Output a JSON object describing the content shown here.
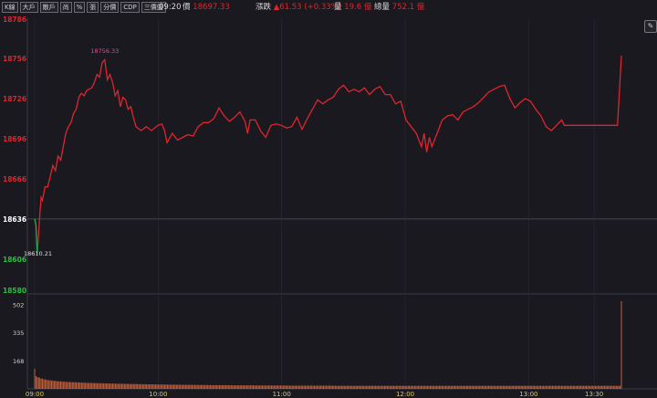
{
  "tabs": [
    "K線",
    "大戶",
    "散戶",
    "尚",
    "%",
    "張",
    "分價",
    "CDP",
    "三價盤"
  ],
  "header": {
    "time": "09:20",
    "price_label": "價",
    "price": "18697.33",
    "change_label": "漲跌",
    "change": "▲61.53 (+0.33%)",
    "volume_label": "量",
    "volume": "19.6 億",
    "total_label": "總量",
    "total": "752.1 億"
  },
  "colors": {
    "line_up": "#e0242c",
    "line_down": "#22b14c",
    "volume": "#c8603a",
    "axis_up": "#e0242c",
    "axis_down": "#22c23a",
    "ref": "#ffffff"
  },
  "chart_data": {
    "type": "line",
    "price_axis": {
      "ylim": [
        18580,
        18786
      ],
      "ticks": [
        "18786",
        "18756",
        "18726",
        "18696",
        "18666",
        "18636",
        "18606",
        "18580"
      ],
      "reference": 18636
    },
    "time_axis": {
      "ticks": [
        "09:00",
        "10:00",
        "11:00",
        "12:00",
        "13:00",
        "13:30"
      ]
    },
    "annotations": {
      "high_label": "18756.33",
      "low_label": "18610.21"
    },
    "series": [
      {
        "values": [
          [
            0,
            18636
          ],
          [
            1,
            18632
          ],
          [
            2,
            18610
          ],
          [
            3,
            18625
          ],
          [
            4,
            18640
          ],
          [
            5,
            18652
          ],
          [
            6,
            18650
          ],
          [
            8,
            18660
          ],
          [
            10,
            18660
          ],
          [
            12,
            18668
          ],
          [
            14,
            18676
          ],
          [
            16,
            18672
          ],
          [
            18,
            18683
          ],
          [
            20,
            18680
          ],
          [
            22,
            18690
          ],
          [
            24,
            18700
          ],
          [
            26,
            18705
          ],
          [
            28,
            18708
          ],
          [
            30,
            18715
          ],
          [
            32,
            18718
          ],
          [
            34,
            18727
          ],
          [
            36,
            18730
          ],
          [
            38,
            18728
          ],
          [
            40,
            18732
          ],
          [
            42,
            18733
          ],
          [
            44,
            18734
          ],
          [
            46,
            18738
          ],
          [
            48,
            18744
          ],
          [
            50,
            18742
          ],
          [
            52,
            18753
          ],
          [
            54,
            18755
          ],
          [
            56,
            18740
          ],
          [
            58,
            18744
          ],
          [
            60,
            18738
          ],
          [
            62,
            18728
          ],
          [
            64,
            18732
          ],
          [
            66,
            18720
          ],
          [
            68,
            18727
          ],
          [
            70,
            18725
          ],
          [
            72,
            18718
          ],
          [
            74,
            18720
          ],
          [
            76,
            18712
          ],
          [
            78,
            18705
          ],
          [
            82,
            18702
          ],
          [
            86,
            18705
          ],
          [
            90,
            18702
          ],
          [
            95,
            18706
          ],
          [
            98,
            18707
          ],
          [
            100,
            18702
          ],
          [
            102,
            18693
          ],
          [
            106,
            18700
          ],
          [
            110,
            18695
          ],
          [
            114,
            18697
          ],
          [
            118,
            18699
          ],
          [
            122,
            18698
          ],
          [
            126,
            18705
          ],
          [
            130,
            18708
          ],
          [
            134,
            18708
          ],
          [
            138,
            18711
          ],
          [
            142,
            18719
          ],
          [
            146,
            18713
          ],
          [
            150,
            18709
          ],
          [
            154,
            18712
          ],
          [
            158,
            18716
          ],
          [
            162,
            18709
          ],
          [
            164,
            18700
          ],
          [
            166,
            18710
          ],
          [
            170,
            18710
          ],
          [
            174,
            18702
          ],
          [
            178,
            18697
          ],
          [
            182,
            18706
          ],
          [
            186,
            18707
          ],
          [
            190,
            18706
          ],
          [
            194,
            18704
          ],
          [
            198,
            18705
          ],
          [
            202,
            18712
          ],
          [
            206,
            18703
          ],
          [
            210,
            18711
          ],
          [
            214,
            18718
          ],
          [
            218,
            18725
          ],
          [
            222,
            18722
          ],
          [
            226,
            18725
          ],
          [
            230,
            18727
          ],
          [
            234,
            18733
          ],
          [
            238,
            18736
          ],
          [
            242,
            18731
          ],
          [
            246,
            18733
          ],
          [
            250,
            18731
          ],
          [
            254,
            18734
          ],
          [
            258,
            18729
          ],
          [
            262,
            18733
          ],
          [
            266,
            18735
          ],
          [
            270,
            18729
          ],
          [
            274,
            18729
          ],
          [
            278,
            18722
          ],
          [
            282,
            18724
          ],
          [
            286,
            18710
          ],
          [
            290,
            18705
          ],
          [
            294,
            18700
          ],
          [
            298,
            18690
          ],
          [
            300,
            18700
          ],
          [
            302,
            18686
          ],
          [
            304,
            18697
          ],
          [
            306,
            18690
          ],
          [
            310,
            18700
          ],
          [
            314,
            18710
          ],
          [
            318,
            18713
          ],
          [
            322,
            18714
          ],
          [
            326,
            18710
          ],
          [
            330,
            18716
          ],
          [
            334,
            18718
          ],
          [
            338,
            18720
          ],
          [
            342,
            18723
          ],
          [
            346,
            18727
          ],
          [
            350,
            18731
          ],
          [
            354,
            18733
          ],
          [
            358,
            18735
          ],
          [
            362,
            18736
          ],
          [
            366,
            18726
          ],
          [
            370,
            18719
          ],
          [
            374,
            18723
          ],
          [
            378,
            18726
          ],
          [
            382,
            18724
          ],
          [
            386,
            18718
          ],
          [
            390,
            18713
          ],
          [
            394,
            18705
          ],
          [
            398,
            18702
          ],
          [
            402,
            18706
          ],
          [
            406,
            18710
          ],
          [
            408,
            18706
          ],
          [
            412,
            18706
          ],
          [
            416,
            18706
          ],
          [
            420,
            18706
          ],
          [
            430,
            18706
          ],
          [
            440,
            18706
          ],
          [
            449,
            18706
          ],
          [
            452,
            18758
          ]
        ]
      }
    ],
    "volume": {
      "ticks": [
        "502",
        "335",
        "168"
      ],
      "ylim": [
        0,
        520
      ],
      "values": [
        120,
        75,
        70,
        68,
        65,
        60,
        62,
        55,
        58,
        54,
        52,
        50,
        52,
        48,
        50,
        46,
        48,
        45,
        46,
        44,
        45,
        44,
        42,
        43,
        41,
        42,
        40,
        41,
        40,
        40,
        39,
        40,
        38,
        39,
        38,
        37,
        38,
        36,
        37,
        36,
        36,
        35,
        36,
        35,
        35,
        34,
        35,
        34,
        34,
        33,
        34,
        33,
        33,
        33,
        32,
        33,
        32,
        32,
        32,
        31,
        32,
        31,
        31,
        31,
        30,
        31,
        30,
        30,
        30,
        30,
        29,
        30,
        29,
        29,
        29,
        29,
        29,
        28,
        29,
        28,
        28,
        28,
        28,
        28,
        27,
        28,
        27,
        27,
        27,
        27,
        27,
        27,
        26,
        27,
        26,
        26,
        26,
        26,
        26,
        26,
        25,
        26,
        25,
        25,
        25,
        25,
        25,
        25,
        25,
        25,
        24,
        25,
        24,
        24,
        24,
        24,
        24,
        24,
        24,
        24,
        24,
        24,
        23,
        24,
        23,
        23,
        23,
        23,
        23,
        23,
        23,
        23,
        23,
        23,
        22,
        23,
        22,
        22,
        22,
        22,
        22,
        22,
        22,
        22,
        22,
        22,
        22,
        22,
        22,
        22,
        21,
        22,
        21,
        21,
        21,
        21,
        21,
        21,
        21,
        21,
        21,
        21,
        21,
        21,
        21,
        21,
        21,
        21,
        21,
        21,
        20,
        21,
        20,
        20,
        20,
        20,
        20,
        20,
        20,
        20,
        20,
        20,
        20,
        20,
        20,
        20,
        20,
        20,
        20,
        20,
        20,
        20,
        20,
        20,
        19,
        20,
        19,
        19,
        19,
        19,
        19,
        19,
        19,
        19,
        19,
        19,
        19,
        19,
        19,
        19,
        19,
        19,
        19,
        19,
        19,
        19,
        19,
        19,
        19,
        19,
        19,
        19,
        19,
        19,
        19,
        19,
        19,
        19,
        19,
        19,
        18,
        19,
        18,
        18,
        18,
        18,
        18,
        18,
        18,
        18,
        18,
        18,
        18,
        18,
        18,
        18,
        18,
        18,
        18,
        18,
        18,
        18,
        18,
        18,
        18,
        18,
        18,
        18,
        18,
        18,
        18,
        18,
        18,
        18,
        18,
        18,
        18,
        18,
        18,
        18,
        18,
        18,
        18,
        18,
        18,
        18,
        18,
        18,
        18,
        18,
        18,
        18,
        18,
        18,
        18,
        18,
        18,
        18,
        18,
        18,
        18,
        18,
        18,
        18,
        18,
        18,
        18,
        18,
        18,
        18,
        18,
        18,
        18,
        18,
        18,
        18,
        18,
        18,
        18,
        18,
        18,
        18,
        18,
        18,
        18,
        18,
        18,
        18,
        18,
        18,
        18,
        18,
        18,
        18,
        18,
        18,
        18,
        18,
        18,
        18,
        18,
        18,
        18,
        18,
        18,
        18,
        18,
        18,
        18,
        18,
        18,
        18,
        18,
        18,
        18,
        18,
        18,
        18,
        18,
        18,
        18,
        18,
        18,
        18,
        18,
        18,
        18,
        18,
        18,
        18,
        18,
        18,
        18,
        18,
        18,
        18,
        18,
        18,
        18,
        18,
        18,
        18,
        18,
        18,
        18,
        18,
        18,
        18,
        18,
        18,
        18,
        18,
        18,
        18,
        18,
        18,
        18,
        18,
        18,
        18,
        18,
        18,
        18,
        18,
        18,
        18,
        18,
        18,
        18,
        18,
        18,
        18,
        18,
        18,
        18,
        18,
        18,
        18,
        18,
        18,
        18,
        18,
        18,
        18,
        18,
        18,
        18,
        18,
        18,
        18,
        18,
        18,
        18,
        18,
        18,
        18,
        18,
        18,
        18,
        18,
        18,
        18,
        18,
        18,
        18,
        18,
        18,
        18,
        18,
        18,
        18,
        18,
        18,
        18,
        18,
        18,
        18,
        18,
        18,
        18,
        18,
        520
      ]
    }
  }
}
